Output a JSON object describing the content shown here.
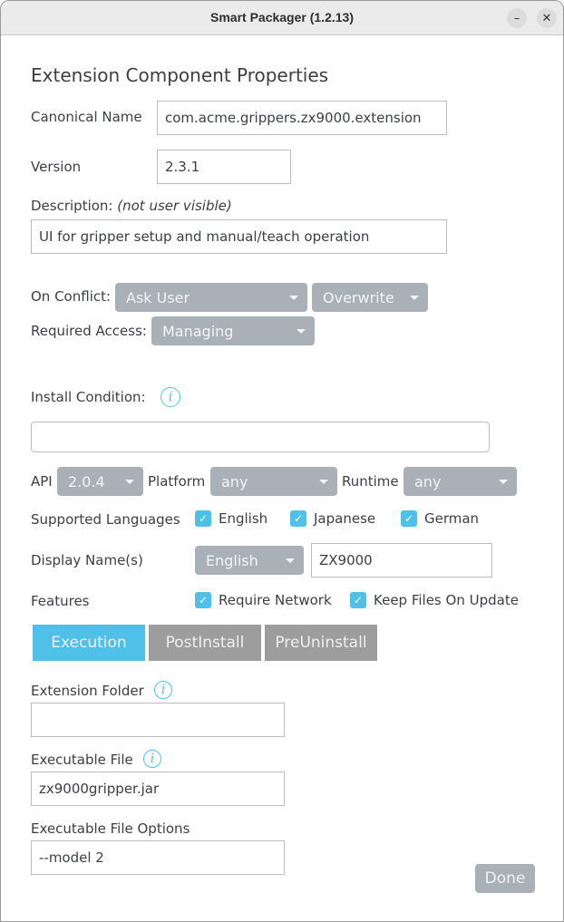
{
  "window": {
    "title": "Smart Packager (1.2.13)",
    "minimize_glyph": "–",
    "close_glyph": "✕"
  },
  "heading": "Extension Component Properties",
  "canonical_name": {
    "label": "Canonical Name",
    "value": "com.acme.grippers.zx9000.extension"
  },
  "version": {
    "label": "Version",
    "value": "2.3.1"
  },
  "description": {
    "label": "Description:",
    "note": "(not user visible)",
    "value": "UI for gripper setup and manual/teach operation"
  },
  "on_conflict": {
    "label": "On Conflict:",
    "primary": "Ask User",
    "secondary": "Overwrite"
  },
  "required_access": {
    "label": "Required Access:",
    "value": "Managing"
  },
  "install_condition": {
    "label": "Install Condition:",
    "info_glyph": "i",
    "value": ""
  },
  "api": {
    "label": "API",
    "value": "2.0.4"
  },
  "platform": {
    "label": "Platform",
    "value": "any"
  },
  "runtime": {
    "label": "Runtime",
    "value": "any"
  },
  "supported_languages": {
    "label": "Supported Languages",
    "items": [
      {
        "label": "English",
        "checked": true
      },
      {
        "label": "Japanese",
        "checked": true
      },
      {
        "label": "German",
        "checked": true
      }
    ]
  },
  "display_names": {
    "label": "Display Name(s)",
    "language": "English",
    "value": "ZX9000"
  },
  "features": {
    "label": "Features",
    "items": [
      {
        "label": "Require Network",
        "checked": true
      },
      {
        "label": "Keep Files On Update",
        "checked": true
      }
    ]
  },
  "check_glyph": "✓",
  "tabs": [
    {
      "label": "Execution",
      "active": true
    },
    {
      "label": "PostInstall",
      "active": false
    },
    {
      "label": "PreUninstall",
      "active": false
    }
  ],
  "execution": {
    "extension_folder": {
      "label": "Extension Folder",
      "value": ""
    },
    "executable_file": {
      "label": "Executable File",
      "value": "zx9000gripper.jar"
    },
    "executable_options": {
      "label": "Executable File Options",
      "value": "--model 2"
    }
  },
  "done_label": "Done",
  "colors": {
    "accent": "#4fc1e9",
    "select_bg": "#aab0b8",
    "tab_inactive": "#9d9d9d",
    "text": "#3b3f45"
  }
}
